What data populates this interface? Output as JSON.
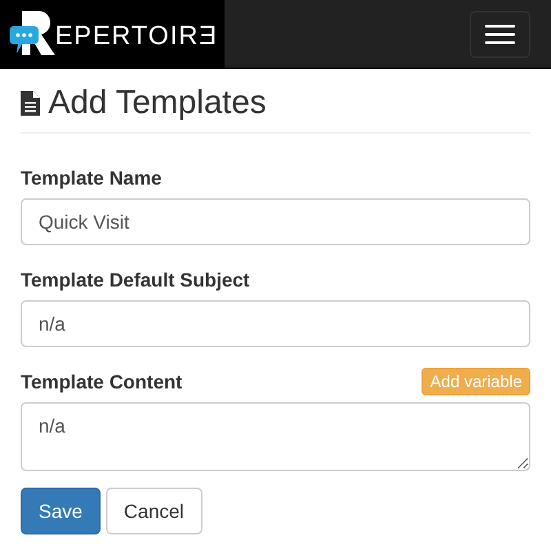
{
  "navbar": {
    "logo_text": "EPERTOIRƎ",
    "menu_button": true
  },
  "page": {
    "title": "Add Templates"
  },
  "fields": [
    {
      "kind": "input",
      "label": "Template Name",
      "value": "Quick Visit"
    },
    {
      "kind": "input",
      "label": "Template Default Subject",
      "value": "n/a"
    },
    {
      "kind": "textarea",
      "label": "Template Content",
      "value": "n/a",
      "action": "Add variable"
    }
  ],
  "buttons": [
    {
      "label": "Save",
      "kind": "primary"
    },
    {
      "label": "Cancel",
      "kind": "default"
    }
  ]
}
